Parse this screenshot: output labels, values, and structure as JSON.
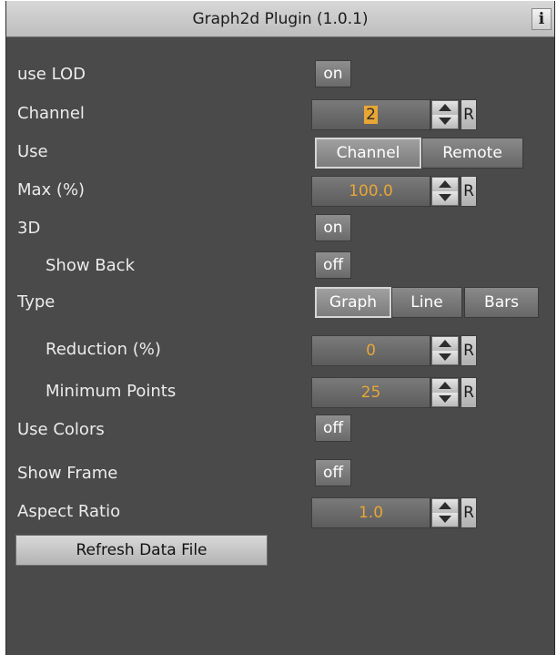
{
  "title": "Graph2d Plugin (1.0.1)",
  "info_label": "i",
  "colors": {
    "panel": "#4a4a4a",
    "value_text": "#e8a634",
    "title_bar": "#c8c8c8"
  },
  "icons": [
    "info-icon",
    "arrow-up-icon",
    "arrow-down-icon"
  ],
  "rows": {
    "use_lod": {
      "label": "use LOD",
      "value": "on"
    },
    "channel": {
      "label": "Channel",
      "value": "2",
      "reset": "R"
    },
    "use": {
      "label": "Use",
      "options": [
        "Channel",
        "Remote"
      ],
      "selected": "Channel"
    },
    "max": {
      "label": "Max (%)",
      "value": "100.0",
      "reset": "R"
    },
    "three_d": {
      "label": "3D",
      "value": "on"
    },
    "show_back": {
      "label": "Show Back",
      "value": "off"
    },
    "type": {
      "label": "Type",
      "options": [
        "Graph",
        "Line",
        "Bars"
      ],
      "selected": "Graph"
    },
    "reduction": {
      "label": "Reduction (%)",
      "value": "0",
      "reset": "R"
    },
    "min_points": {
      "label": "Minimum Points",
      "value": "25",
      "reset": "R"
    },
    "use_colors": {
      "label": "Use Colors",
      "value": "off"
    },
    "show_frame": {
      "label": "Show Frame",
      "value": "off"
    },
    "aspect_ratio": {
      "label": "Aspect Ratio",
      "value": "1.0",
      "reset": "R"
    }
  },
  "refresh_label": "Refresh Data File"
}
